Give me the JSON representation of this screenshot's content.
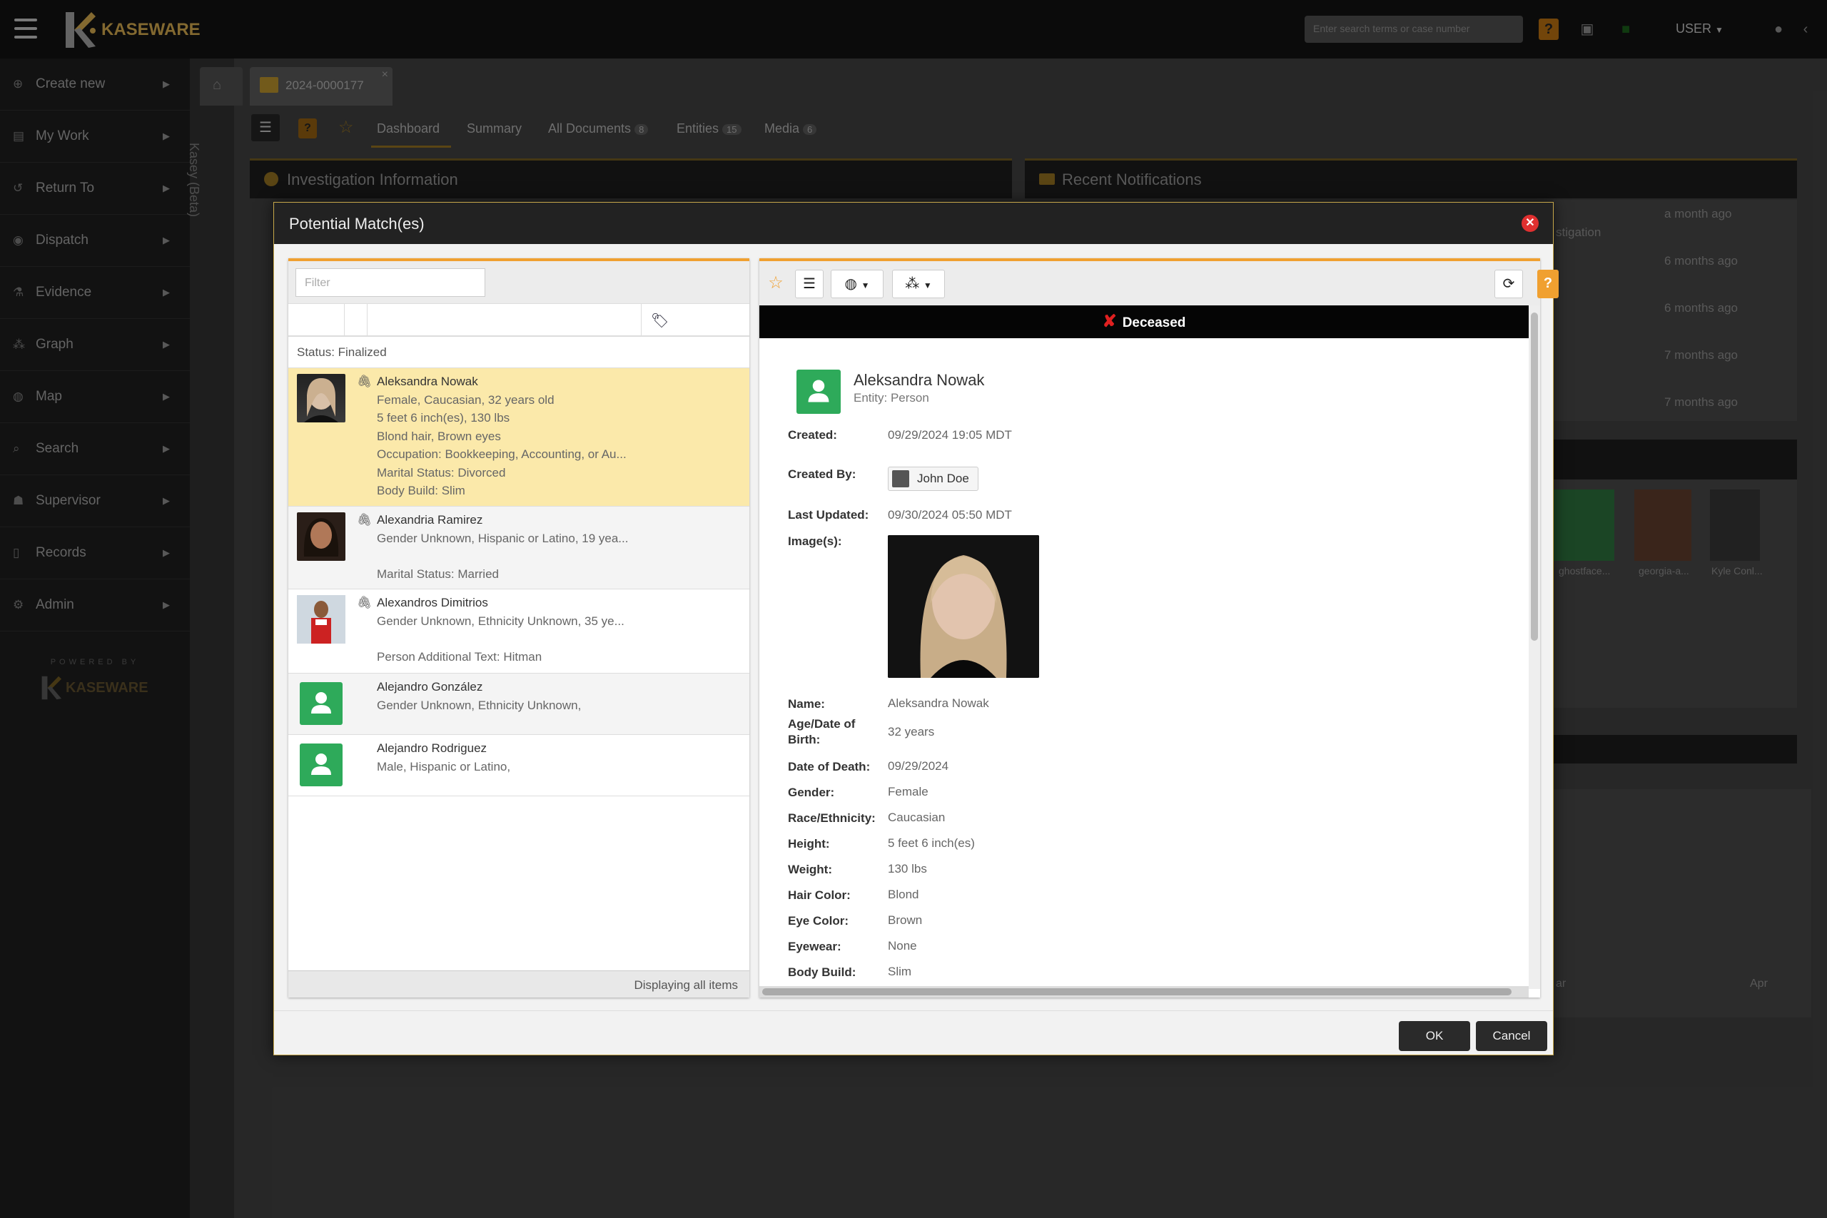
{
  "app": {
    "brand": "KASEWARE",
    "search_placeholder": "Enter search terms or case number",
    "user_label": "USER",
    "powered_by": "POWERED BY"
  },
  "sidebar": {
    "items": [
      {
        "label": "Create new",
        "icon": "plus-circle-icon"
      },
      {
        "label": "My Work",
        "icon": "briefcase-icon"
      },
      {
        "label": "Return To",
        "icon": "return-icon"
      },
      {
        "label": "Dispatch",
        "icon": "pin-icon"
      },
      {
        "label": "Evidence",
        "icon": "evidence-icon"
      },
      {
        "label": "Graph",
        "icon": "graph-icon"
      },
      {
        "label": "Map",
        "icon": "globe-icon"
      },
      {
        "label": "Search",
        "icon": "search-icon"
      },
      {
        "label": "Supervisor",
        "icon": "users-icon"
      },
      {
        "label": "Records",
        "icon": "file-icon"
      },
      {
        "label": "Admin",
        "icon": "gears-icon"
      }
    ],
    "kasey": "Kasey (Beta)"
  },
  "case_tab": "2024-0000177",
  "subtabs": [
    {
      "label": "Dashboard",
      "count": ""
    },
    {
      "label": "Summary",
      "count": ""
    },
    {
      "label": "All Documents",
      "count": "8"
    },
    {
      "label": "Entities",
      "count": "15"
    },
    {
      "label": "Media",
      "count": "6"
    }
  ],
  "panels": {
    "investigation": "Investigation Information",
    "notifications": "Recent Notifications",
    "notification_times": [
      "a month ago",
      "6 months ago",
      "6 months ago",
      "7 months ago",
      "7 months ago"
    ],
    "notif_fragment": "stigation",
    "media_labels": [
      "ghostface...",
      "georgia-a...",
      "Kyle Conl..."
    ],
    "timeline_labels": [
      "Apr",
      "ar"
    ]
  },
  "modal": {
    "title": "Potential Match(es)",
    "filter_placeholder": "Filter",
    "status": "Status: Finalized",
    "footer": "Displaying all items",
    "ok": "OK",
    "cancel": "Cancel",
    "matches": [
      {
        "name": "Aleksandra Nowak",
        "lines": [
          "Female, Caucasian, 32 years old",
          "5 feet 6 inch(es), 130 lbs",
          "Blond hair, Brown eyes",
          "Occupation: Bookkeeping, Accounting, or Au...",
          "Marital Status: Divorced",
          "Body Build: Slim"
        ],
        "photo": true,
        "clip": true
      },
      {
        "name": "Alexandria Ramirez",
        "lines": [
          "Gender Unknown, Hispanic or Latino, 19 yea...",
          "",
          "Marital Status: Married"
        ],
        "photo": true,
        "clip": true
      },
      {
        "name": "Alexandros Dimitrios",
        "lines": [
          "Gender Unknown, Ethnicity Unknown, 35 ye...",
          "",
          "Person Additional Text: Hitman"
        ],
        "photo": true,
        "clip": true
      },
      {
        "name": "Alejandro González",
        "lines": [
          "Gender Unknown, Ethnicity Unknown,"
        ],
        "photo": false,
        "clip": false
      },
      {
        "name": "Alejandro Rodriguez",
        "lines": [
          "Male, Hispanic or Latino,"
        ],
        "photo": false,
        "clip": false
      }
    ],
    "detail": {
      "banner": "Deceased",
      "name": "Aleksandra Nowak",
      "entity_type": "Entity: Person",
      "created_label": "Created:",
      "created": "09/29/2024 19:05 MDT",
      "created_by_label": "Created By:",
      "created_by": "John Doe",
      "updated_label": "Last Updated:",
      "updated": "09/30/2024 05:50 MDT",
      "images_label": "Image(s):",
      "fields": [
        {
          "label": "Name:",
          "value": "Aleksandra Nowak"
        },
        {
          "label": "Age/Date of Birth:",
          "value": "32 years"
        },
        {
          "label": "Date of Death:",
          "value": "09/29/2024"
        },
        {
          "label": "Gender:",
          "value": "Female"
        },
        {
          "label": "Race/Ethnicity:",
          "value": "Caucasian"
        },
        {
          "label": "Height:",
          "value": "5 feet 6 inch(es)"
        },
        {
          "label": "Weight:",
          "value": "130 lbs"
        },
        {
          "label": "Hair Color:",
          "value": "Blond"
        },
        {
          "label": "Eye Color:",
          "value": "Brown"
        },
        {
          "label": "Eyewear:",
          "value": "None"
        },
        {
          "label": "Body Build:",
          "value": "Slim"
        }
      ]
    }
  },
  "colors": {
    "accent": "#f0a030",
    "selected_row": "#fbe9aa",
    "avatar_green": "#2eaa5a",
    "brand_gold": "#c9a24a"
  }
}
